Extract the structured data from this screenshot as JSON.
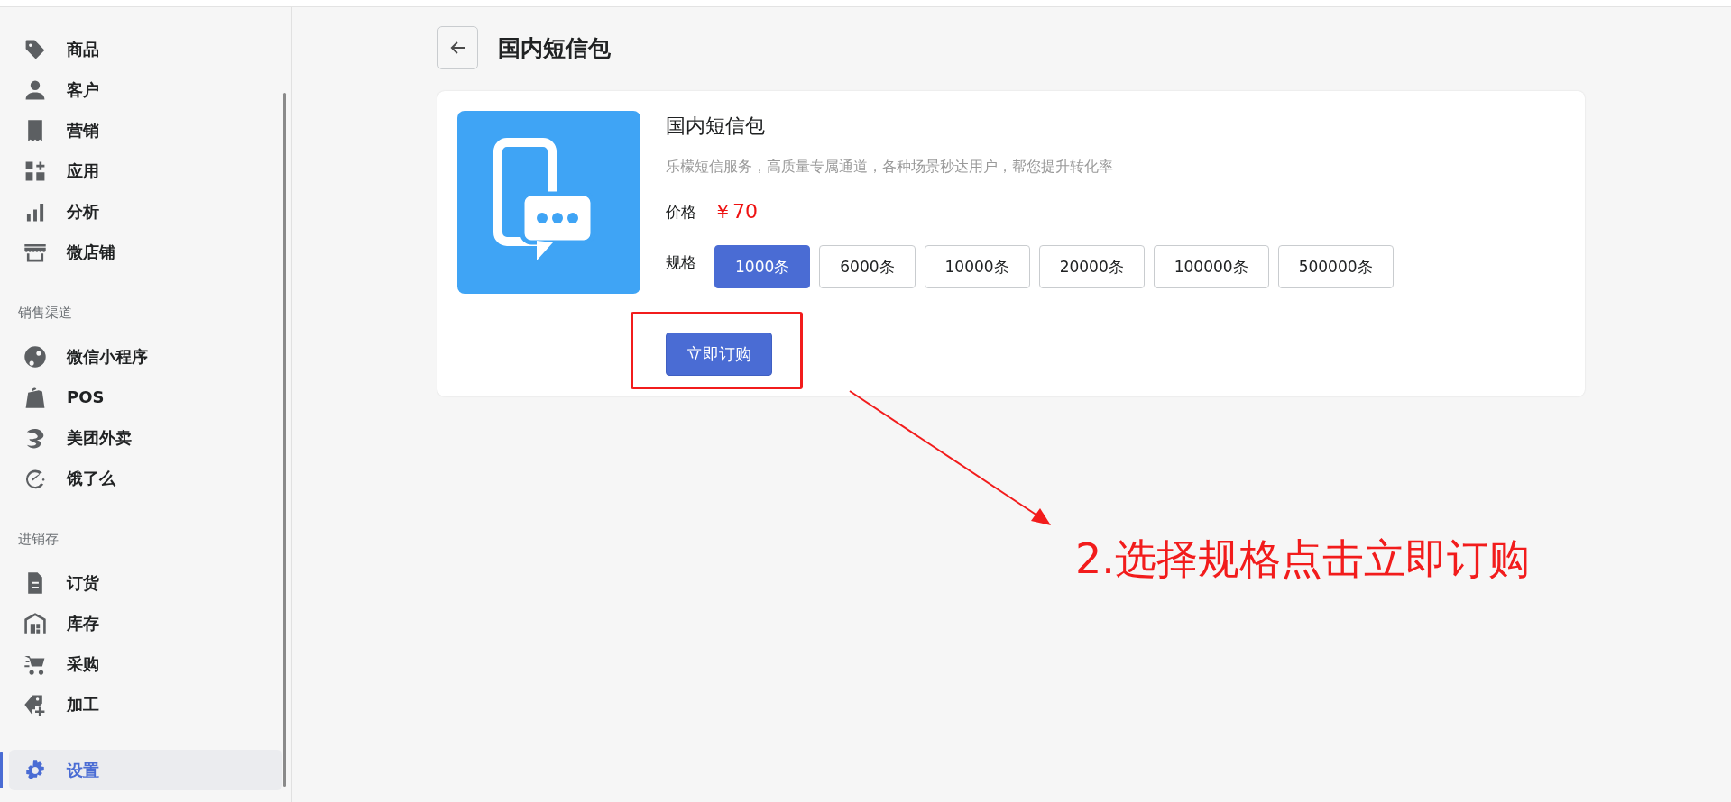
{
  "sidebar": {
    "sections": [
      {
        "items": [
          {
            "label": "商品",
            "selected": false
          },
          {
            "label": "客户",
            "selected": false
          },
          {
            "label": "营销",
            "selected": false
          },
          {
            "label": "应用",
            "selected": false
          },
          {
            "label": "分析",
            "selected": false
          },
          {
            "label": "微店铺",
            "selected": false
          }
        ]
      },
      {
        "heading": "销售渠道",
        "items": [
          {
            "label": "微信小程序",
            "selected": false
          },
          {
            "label": "POS",
            "selected": false
          },
          {
            "label": "美团外卖",
            "selected": false
          },
          {
            "label": "饿了么",
            "selected": false
          }
        ]
      },
      {
        "heading": "进销存",
        "items": [
          {
            "label": "订货",
            "selected": false
          },
          {
            "label": "库存",
            "selected": false
          },
          {
            "label": "采购",
            "selected": false
          },
          {
            "label": "加工",
            "selected": false
          }
        ]
      },
      {
        "items": [
          {
            "label": "设置",
            "selected": true
          }
        ]
      }
    ]
  },
  "page": {
    "title": "国内短信包"
  },
  "product": {
    "name": "国内短信包",
    "description": "乐檬短信服务，高质量专属通道，各种场景秒达用户，帮您提升转化率",
    "price_label": "价格",
    "price": "￥70",
    "spec_label": "规格",
    "specs": [
      {
        "label": "1000条",
        "selected": true
      },
      {
        "label": "6000条",
        "selected": false
      },
      {
        "label": "10000条",
        "selected": false
      },
      {
        "label": "20000条",
        "selected": false
      },
      {
        "label": "100000条",
        "selected": false
      },
      {
        "label": "500000条",
        "selected": false
      }
    ],
    "order_button": "立即订购"
  },
  "annotation": {
    "text": "2.选择规格点击立即订购"
  }
}
